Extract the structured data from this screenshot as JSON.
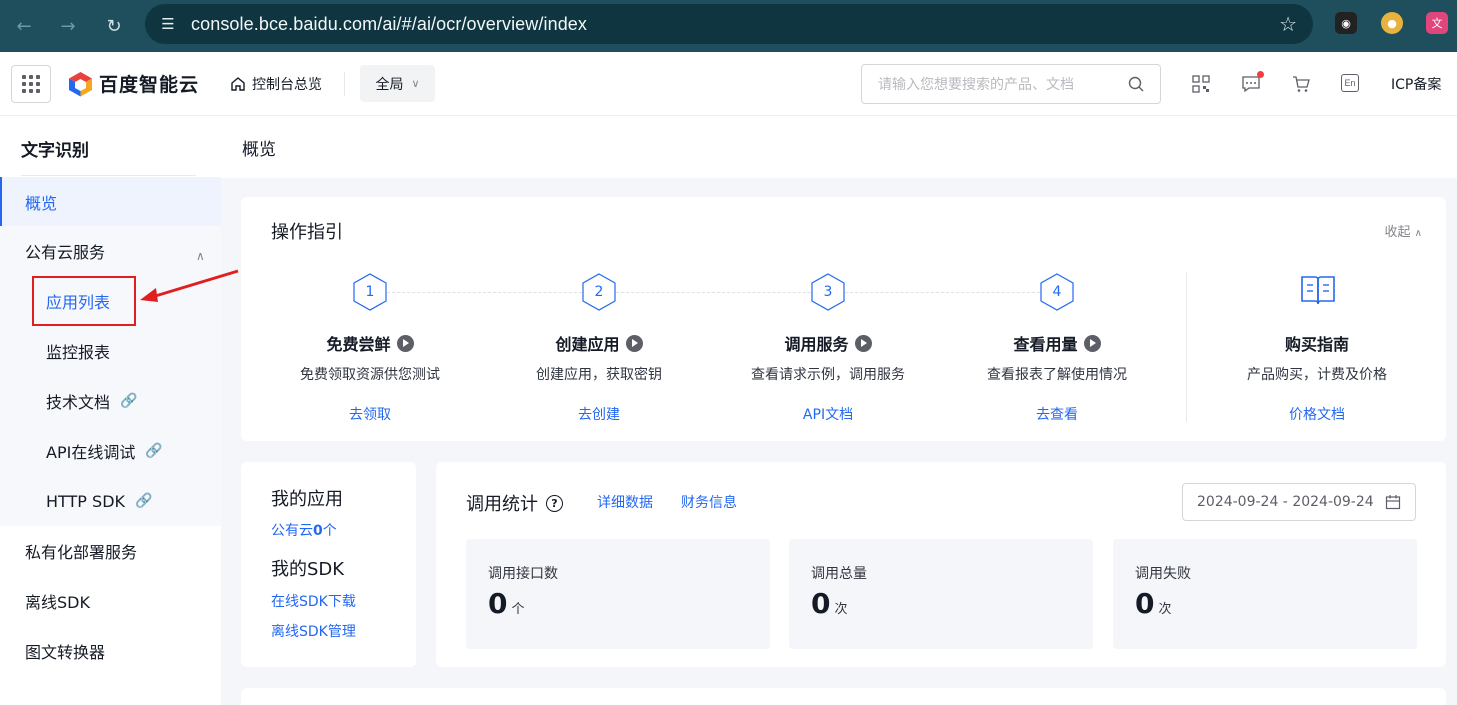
{
  "browser": {
    "url": "console.bce.baidu.com/ai/#/ai/ocr/overview/index"
  },
  "header": {
    "brand": "百度智能云",
    "console_home": "控制台总览",
    "region": "全局",
    "search_placeholder": "请输入您想要搜索的产品、文档",
    "lang_badge": "En",
    "icp": "ICP备案"
  },
  "sidebar": {
    "title": "文字识别",
    "items": [
      {
        "label": "概览"
      },
      {
        "label": "公有云服务"
      },
      {
        "label": "私有化部署服务"
      },
      {
        "label": "离线SDK"
      },
      {
        "label": "图文转换器"
      }
    ],
    "sub_items": [
      {
        "label": "应用列表"
      },
      {
        "label": "监控报表"
      },
      {
        "label": "技术文档"
      },
      {
        "label": "API在线调试"
      },
      {
        "label": "HTTP SDK"
      }
    ]
  },
  "content": {
    "title": "概览",
    "guide": {
      "title": "操作指引",
      "collapse": "收起",
      "steps": [
        {
          "num": "1",
          "name": "免费尝鲜",
          "desc": "免费领取资源供您测试",
          "link": "去领取"
        },
        {
          "num": "2",
          "name": "创建应用",
          "desc": "创建应用，获取密钥",
          "link": "去创建"
        },
        {
          "num": "3",
          "name": "调用服务",
          "desc": "查看请求示例，调用服务",
          "link": "API文档"
        },
        {
          "num": "4",
          "name": "查看用量",
          "desc": "查看报表了解使用情况",
          "link": "去查看"
        }
      ],
      "purchase": {
        "name": "购买指南",
        "desc": "产品购买，计费及价格",
        "link": "价格文档"
      }
    },
    "my_apps": {
      "title": "我的应用",
      "public_prefix": "公有云",
      "public_count": "0",
      "public_suffix": "个",
      "sdk_title": "我的SDK",
      "sdk_download": "在线SDK下载",
      "sdk_manage": "离线SDK管理"
    },
    "stats": {
      "title": "调用统计",
      "detail_link": "详细数据",
      "finance_link": "财务信息",
      "date_range": "2024-09-24 - 2024-09-24",
      "boxes": [
        {
          "label": "调用接口数",
          "value": "0",
          "unit": "个"
        },
        {
          "label": "调用总量",
          "value": "0",
          "unit": "次"
        },
        {
          "label": "调用失败",
          "value": "0",
          "unit": "次"
        }
      ]
    }
  },
  "colors": {
    "accent": "#2468f2",
    "highlight": "#e02020",
    "browser": "#1f4f5c"
  }
}
